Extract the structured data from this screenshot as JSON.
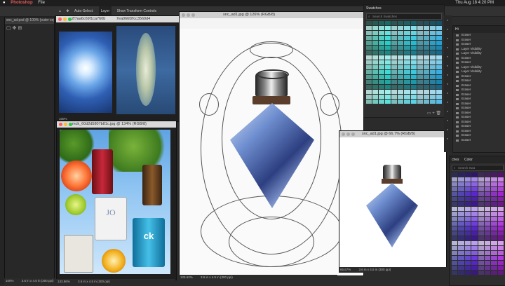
{
  "menubar": {
    "app": "Photoshop",
    "file": "File",
    "clock": "Thu Aug 18  4:20 PM"
  },
  "options": {
    "auto_select": "Auto-Select:",
    "layer": "Layer",
    "show_transform": "Show Transform Controls"
  },
  "tabs": [
    {
      "label": "2f7aa6c69f1ca760b"
    },
    {
      "label": "7ea066f2fcc3569d4"
    },
    {
      "label": "snc_ad1.jpg @ 126% (RGB/8)"
    },
    {
      "label": "mck_60d2d5807b81c.jpg @ 134% (RGB/8)"
    },
    {
      "label": "snc_ad1.jpg @ 66.7% (RGB/8)"
    }
  ],
  "left_doc": {
    "label": "snc_ad.psd @ 100% (outer copy,",
    "zoom": "100%",
    "status": "3.6 in x 4.5 in (300 ppi)"
  },
  "mck": {
    "zoom": "133.86%",
    "status": "3.6 in x 4.5 in (300 ppi)",
    "bottle_brand": "JO",
    "ck_label": "ck"
  },
  "main_doc": {
    "zoom": "125.62%",
    "status": "3.6 in x 4.5 in (300 ppi)"
  },
  "small_doc": {
    "zoom": "66.67%",
    "status": "3.6 in x 4.5 in (300 ppi)"
  },
  "thumb_zoom": "100%",
  "swatches": {
    "tab": "Swatches",
    "search": "Search Swatches"
  },
  "history": {
    "tab": "Hi",
    "items": [
      "Eraser",
      "Eraser",
      "Eraser",
      "Layer Visibility",
      "Layer Visibility",
      "Eraser",
      "Eraser",
      "Layer Visibility",
      "Layer Visibility",
      "Eraser",
      "Eraser",
      "Eraser",
      "Eraser",
      "Eraser",
      "Eraser",
      "Eraser",
      "Eraser",
      "Eraser",
      "Eraser",
      "Eraser",
      "Eraser",
      "Eraser",
      "Eraser",
      "Eraser"
    ]
  },
  "bottom_panel": {
    "tab1": "ches",
    "tab2": "Color",
    "search": "Search Swa"
  },
  "colors": {
    "teal": "#0e7f86",
    "purple": "#6a4fa3",
    "blue_bottle": "#6f8fd0"
  }
}
